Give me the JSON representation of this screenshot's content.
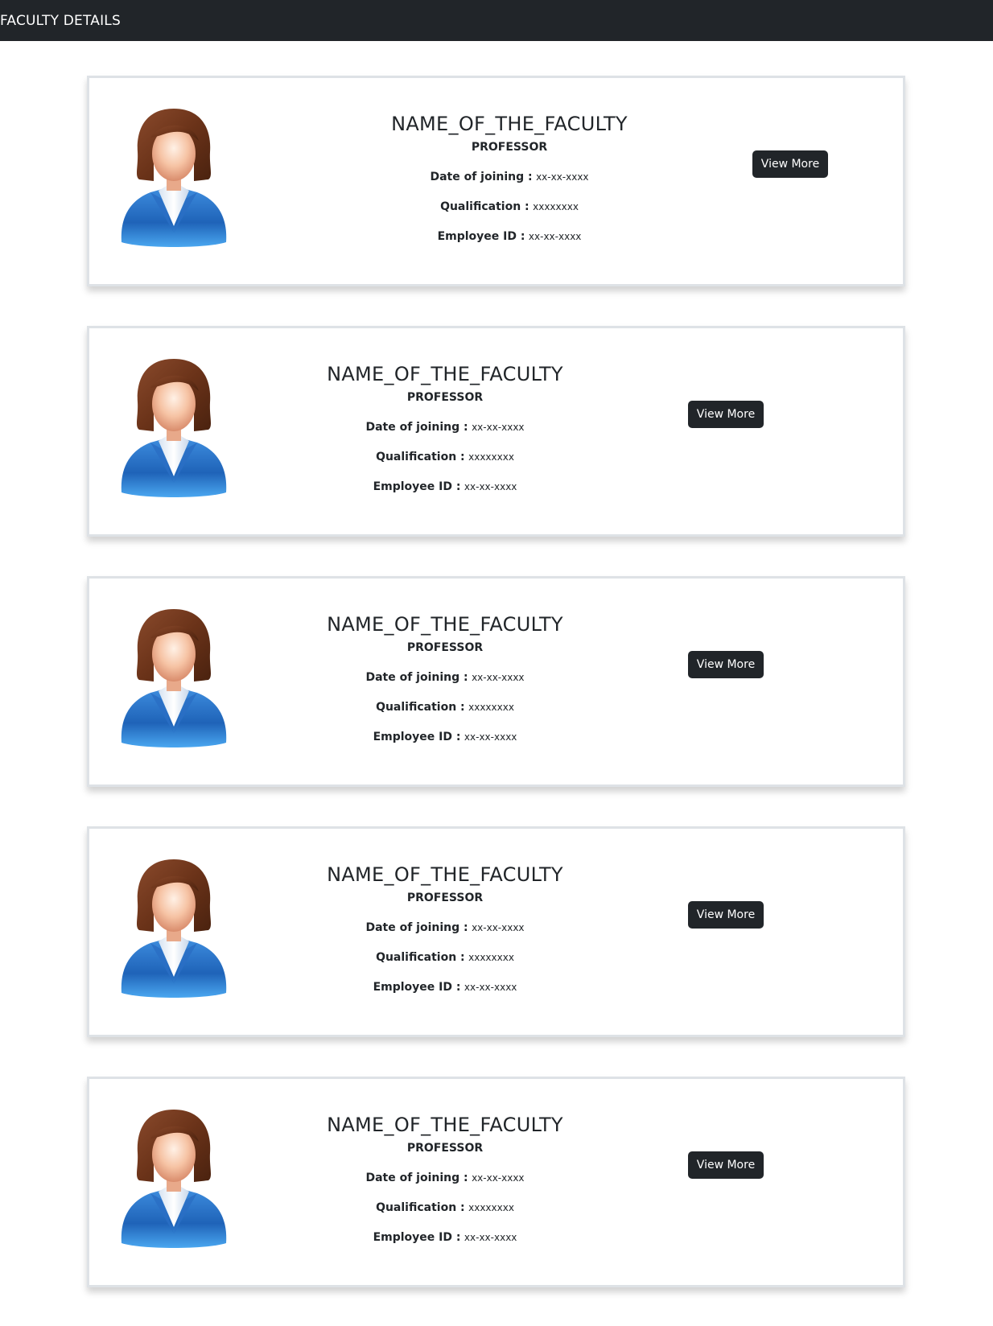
{
  "header": {
    "title": "FACULTY DETAILS"
  },
  "labels": {
    "date_of_joining": "Date of joining :",
    "qualification": "Qualification :",
    "employee_id": "Employee ID :"
  },
  "faculty": [
    {
      "name": "NAME_OF_THE_FACULTY",
      "designation": "PROFESSOR",
      "date_of_joining": "xx-xx-xxxx",
      "qualification": "xxxxxxxx",
      "employee_id": "xx-xx-xxxx",
      "button": "View More"
    },
    {
      "name": "NAME_OF_THE_FACULTY",
      "designation": "PROFESSOR",
      "date_of_joining": "xx-xx-xxxx",
      "qualification": "xxxxxxxx",
      "employee_id": "xx-xx-xxxx",
      "button": "View More"
    },
    {
      "name": "NAME_OF_THE_FACULTY",
      "designation": "PROFESSOR",
      "date_of_joining": "xx-xx-xxxx",
      "qualification": "xxxxxxxx",
      "employee_id": "xx-xx-xxxx",
      "button": "View More"
    },
    {
      "name": "NAME_OF_THE_FACULTY",
      "designation": "PROFESSOR",
      "date_of_joining": "xx-xx-xxxx",
      "qualification": "xxxxxxxx",
      "employee_id": "xx-xx-xxxx",
      "button": "View More"
    },
    {
      "name": "NAME_OF_THE_FACULTY",
      "designation": "PROFESSOR",
      "date_of_joining": "xx-xx-xxxx",
      "qualification": "xxxxxxxx",
      "employee_id": "xx-xx-xxxx",
      "button": "View More"
    }
  ],
  "icons": {
    "avatar": "female-avatar-icon"
  },
  "colors": {
    "header_bg": "#212529",
    "button_bg": "#212529",
    "card_border": "#dee2e6"
  }
}
